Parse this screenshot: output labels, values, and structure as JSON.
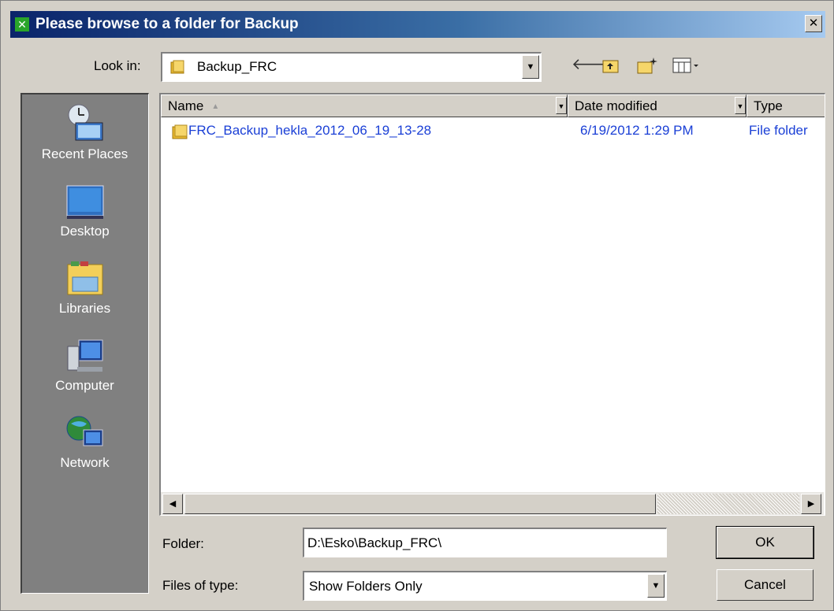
{
  "window": {
    "title": "Please browse to a folder for Backup",
    "close_glyph": "✕"
  },
  "toolbar": {
    "lookin_label": "Look in:",
    "lookin_value": "Backup_FRC",
    "back_icon": "back-arrow-icon",
    "up_icon": "up-one-level-icon",
    "new_folder_icon": "new-folder-icon",
    "views_icon": "views-menu-icon"
  },
  "places": [
    {
      "label": "Recent Places",
      "icon": "recent-places-icon"
    },
    {
      "label": "Desktop",
      "icon": "desktop-icon"
    },
    {
      "label": "Libraries",
      "icon": "libraries-icon"
    },
    {
      "label": "Computer",
      "icon": "computer-icon"
    },
    {
      "label": "Network",
      "icon": "network-icon"
    }
  ],
  "columns": [
    "Name",
    "Date modified",
    "Type"
  ],
  "files": [
    {
      "name": "FRC_Backup_hekla_2012_06_19_13-28",
      "date": "6/19/2012 1:29 PM",
      "type": "File folder"
    }
  ],
  "form": {
    "folder_label": "Folder:",
    "folder_value": "D:\\Esko\\Backup_FRC\\",
    "type_label": "Files of type:",
    "type_value": "Show Folders Only",
    "ok_label": "OK",
    "cancel_label": "Cancel"
  },
  "colors": {
    "title_gradient_start": "#0a246a",
    "title_gradient_end": "#a6caf0",
    "link_blue": "#1a3fd6",
    "places_bg": "#808080",
    "dialog_bg": "#d4d0c8"
  }
}
